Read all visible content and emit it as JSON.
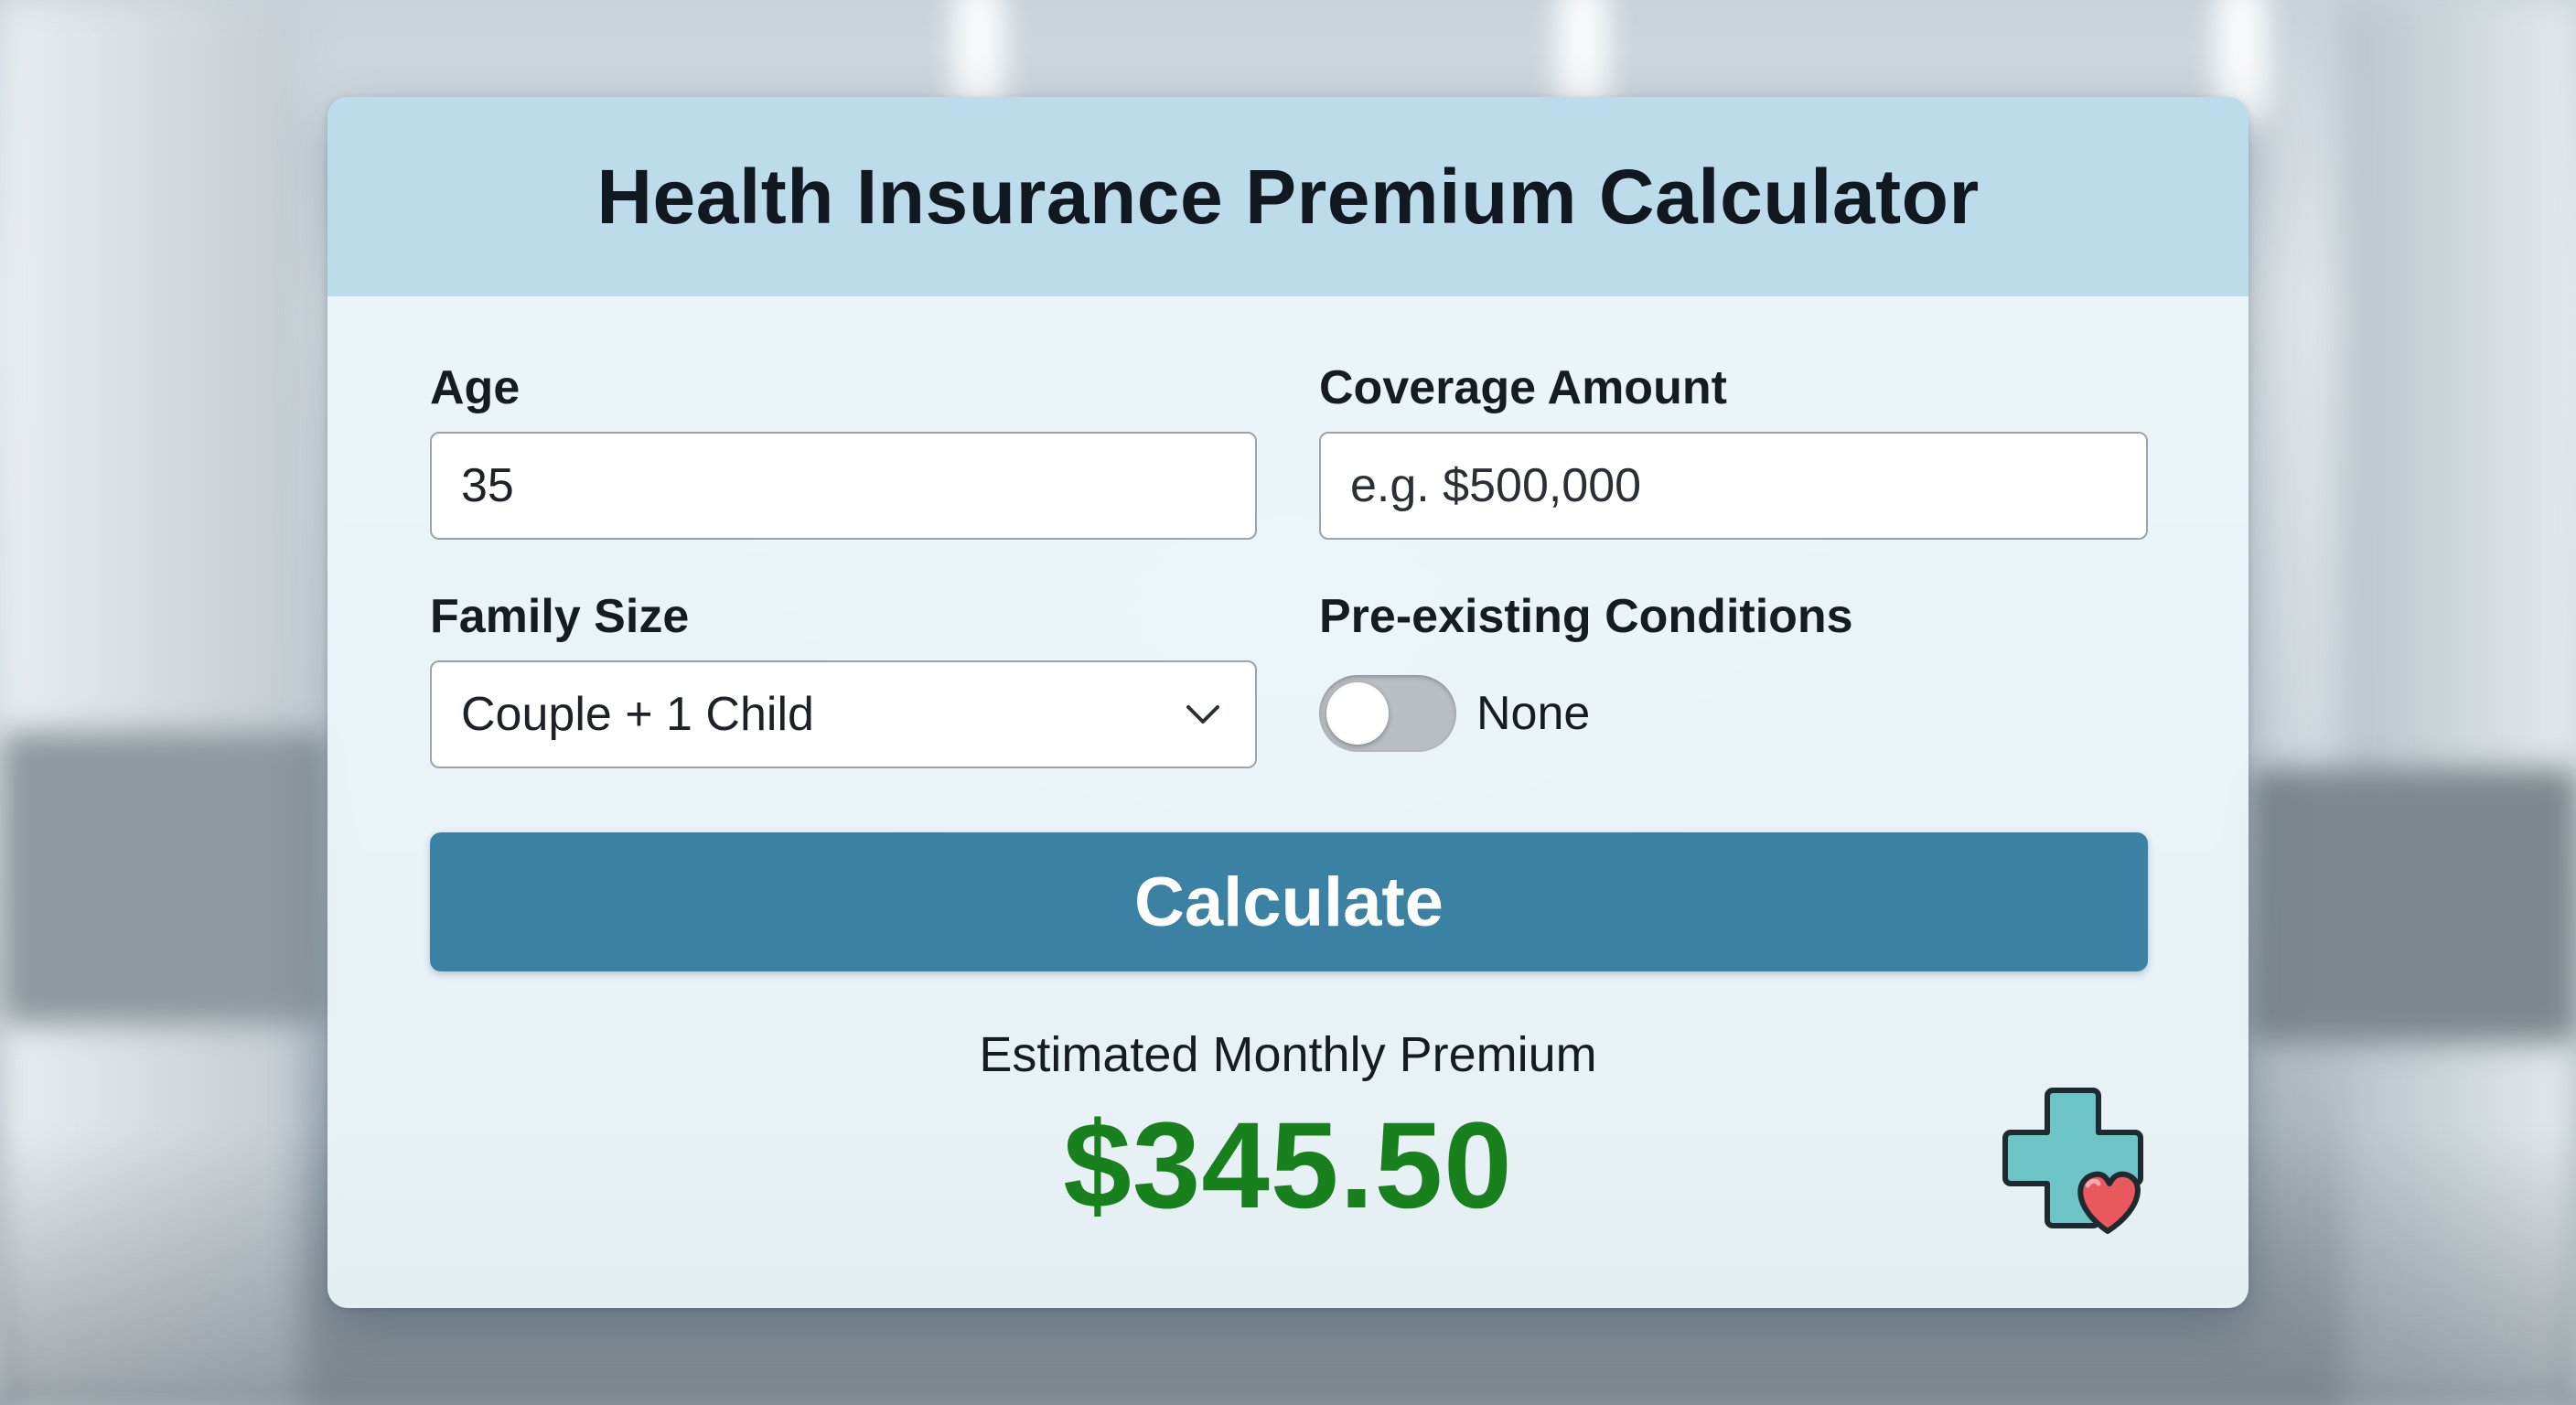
{
  "header": {
    "title": "Health Insurance Premium Calculator"
  },
  "form": {
    "age": {
      "label": "Age",
      "value": "35"
    },
    "coverage": {
      "label": "Coverage Amount",
      "placeholder": "e.g. $500,000"
    },
    "family_size": {
      "label": "Family Size",
      "selected": "Couple + 1 Child"
    },
    "conditions": {
      "label": "Pre-existing Conditions",
      "toggle_on": false,
      "toggle_text": "None"
    }
  },
  "actions": {
    "calculate_label": "Calculate"
  },
  "result": {
    "label": "Estimated Monthly Premium",
    "value": "$345.50"
  },
  "colors": {
    "header_bg": "#bcdcec",
    "button_bg": "#3a81a4",
    "result_green": "#18801c",
    "cross_teal": "#6cc4c6",
    "heart_red": "#e8585c"
  },
  "icons": {
    "select_chevron": "chevron-down-icon",
    "brand": "medical-cross-heart-icon"
  }
}
